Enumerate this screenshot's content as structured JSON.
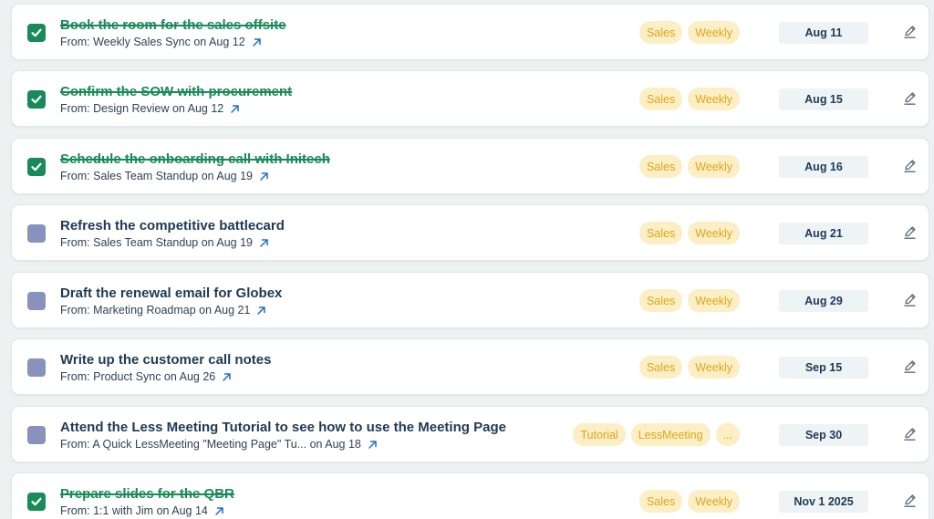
{
  "colors": {
    "done": "#1b8a5a",
    "pending_checkbox": "#8892bd",
    "title": "#1e3a56",
    "tag_bg": "#fcefc6",
    "tag_text": "#e0a516",
    "link_arrow": "#1f6fc4"
  },
  "icons": {
    "checkbox_checked": "check-icon",
    "source_link": "arrow-up-right-icon",
    "edit": "pencil-icon"
  },
  "tasks": [
    {
      "title": "Book the room for the sales offsite",
      "from": "From: Weekly Sales Sync on Aug 12",
      "tags": [
        "Sales",
        "Weekly"
      ],
      "date": "Aug 11",
      "done": true
    },
    {
      "title": "Confirm the SOW with procurement",
      "from": "From: Design Review on Aug 12",
      "tags": [
        "Sales",
        "Weekly"
      ],
      "date": "Aug 15",
      "done": true
    },
    {
      "title": "Schedule the onboarding call with Initech",
      "from": "From: Sales Team Standup on Aug 19",
      "tags": [
        "Sales",
        "Weekly"
      ],
      "date": "Aug 16",
      "done": true
    },
    {
      "title": "Refresh the competitive battlecard",
      "from": "From: Sales Team Standup on Aug 19",
      "tags": [
        "Sales",
        "Weekly"
      ],
      "date": "Aug 21",
      "done": false
    },
    {
      "title": "Draft the renewal email for Globex",
      "from": "From: Marketing Roadmap on Aug 21",
      "tags": [
        "Sales",
        "Weekly"
      ],
      "date": "Aug 29",
      "done": false
    },
    {
      "title": "Write up the customer call notes",
      "from": "From: Product Sync on Aug 26",
      "tags": [
        "Sales",
        "Weekly"
      ],
      "date": "Sep 15",
      "done": false
    },
    {
      "title": "Attend the Less Meeting Tutorial to see how to use the Meeting Page",
      "from": "From: A Quick LessMeeting \"Meeting Page\" Tu... on Aug 18",
      "tags": [
        "Tutorial",
        "LessMeeting",
        "..."
      ],
      "date": "Sep 30",
      "done": false
    },
    {
      "title": "Prepare slides for the QBR",
      "from": "From: 1:1 with Jim on Aug 14",
      "tags": [
        "Sales",
        "Weekly"
      ],
      "date": "Nov 1 2025",
      "done": true
    }
  ]
}
